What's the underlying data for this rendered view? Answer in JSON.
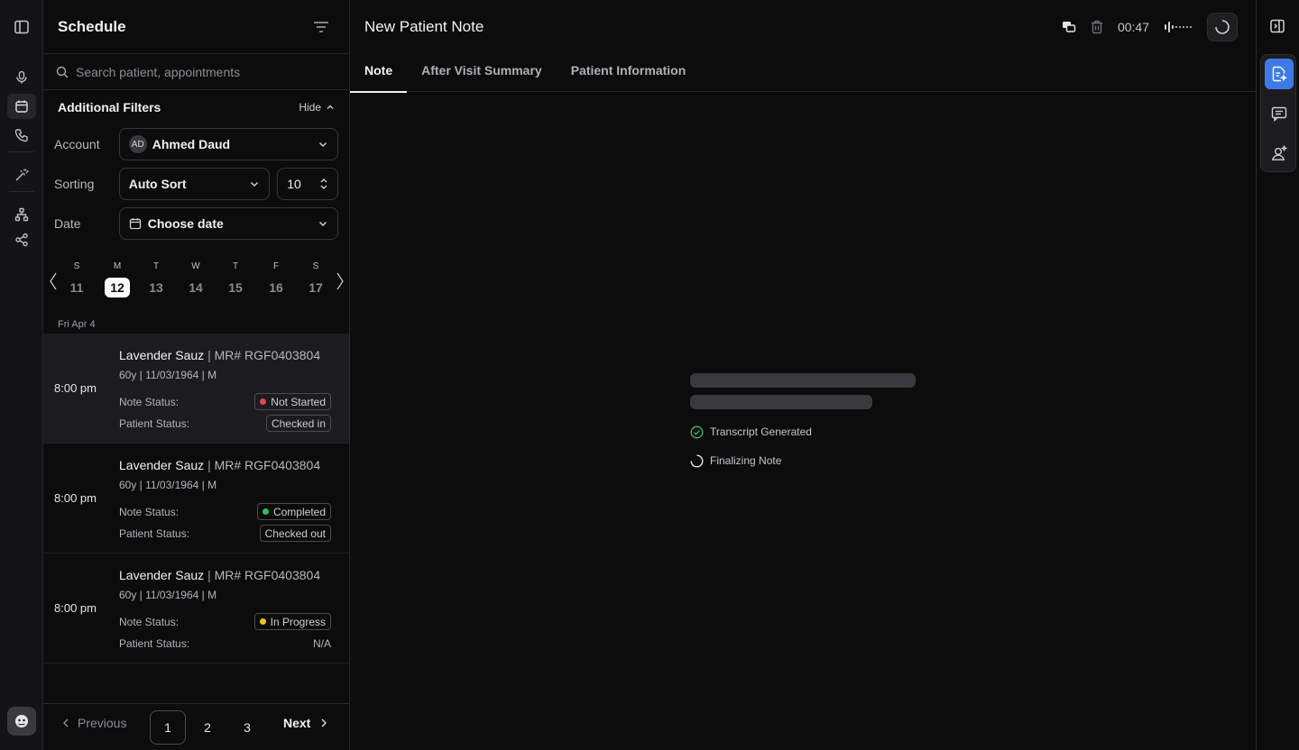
{
  "schedule": {
    "title": "Schedule",
    "search_placeholder": "Search patient, appointments",
    "filters": {
      "title": "Additional Filters",
      "hide_label": "Hide",
      "account_label": "Account",
      "account_initials": "AD",
      "account_value": "Ahmed Daud",
      "sorting_label": "Sorting",
      "sorting_value": "Auto Sort",
      "page_size": "10",
      "date_label": "Date",
      "date_value": "Choose date"
    },
    "week": [
      {
        "letter": "S",
        "num": "11"
      },
      {
        "letter": "M",
        "num": "12"
      },
      {
        "letter": "T",
        "num": "13"
      },
      {
        "letter": "W",
        "num": "14"
      },
      {
        "letter": "T",
        "num": "15"
      },
      {
        "letter": "F",
        "num": "16"
      },
      {
        "letter": "S",
        "num": "17"
      }
    ],
    "date_group": "Fri Apr 4",
    "appointments": [
      {
        "time": "8:00 pm",
        "name": "Lavender Sauz",
        "sep": " | ",
        "mr": "MR# RGF0403804",
        "meta": "60y | 11/03/1964 | M",
        "note_label": "Note Status:",
        "note_status": "Not Started",
        "patient_label": "Patient Status:",
        "patient_status": "Checked in"
      },
      {
        "time": "8:00 pm",
        "name": "Lavender Sauz",
        "sep": " | ",
        "mr": "MR# RGF0403804",
        "meta": "60y | 11/03/1964 | M",
        "note_label": "Note Status:",
        "note_status": "Completed",
        "patient_label": "Patient Status:",
        "patient_status": "Checked out"
      },
      {
        "time": "8:00 pm",
        "name": "Lavender Sauz",
        "sep": " | ",
        "mr": "MR# RGF0403804",
        "meta": "60y | 11/03/1964 | M",
        "note_label": "Note Status:",
        "note_status": "In Progress",
        "patient_label": "Patient Status:",
        "patient_status": "N/A"
      }
    ],
    "pager": {
      "previous": "Previous",
      "pages": [
        "1",
        "2",
        "3"
      ],
      "next": "Next"
    }
  },
  "main": {
    "title": "New Patient Note",
    "timer": "00:47",
    "tabs": [
      "Note",
      "After Visit Summary",
      "Patient Information"
    ],
    "status": {
      "step1": "Transcript Generated",
      "step2": "Finalizing Note"
    }
  },
  "colors": {
    "status_red": "#e5484d",
    "status_green": "#2fbf55",
    "status_yellow": "#f5c518",
    "accent_blue": "#3d7ae8",
    "success_check": "#3fbf6a"
  }
}
